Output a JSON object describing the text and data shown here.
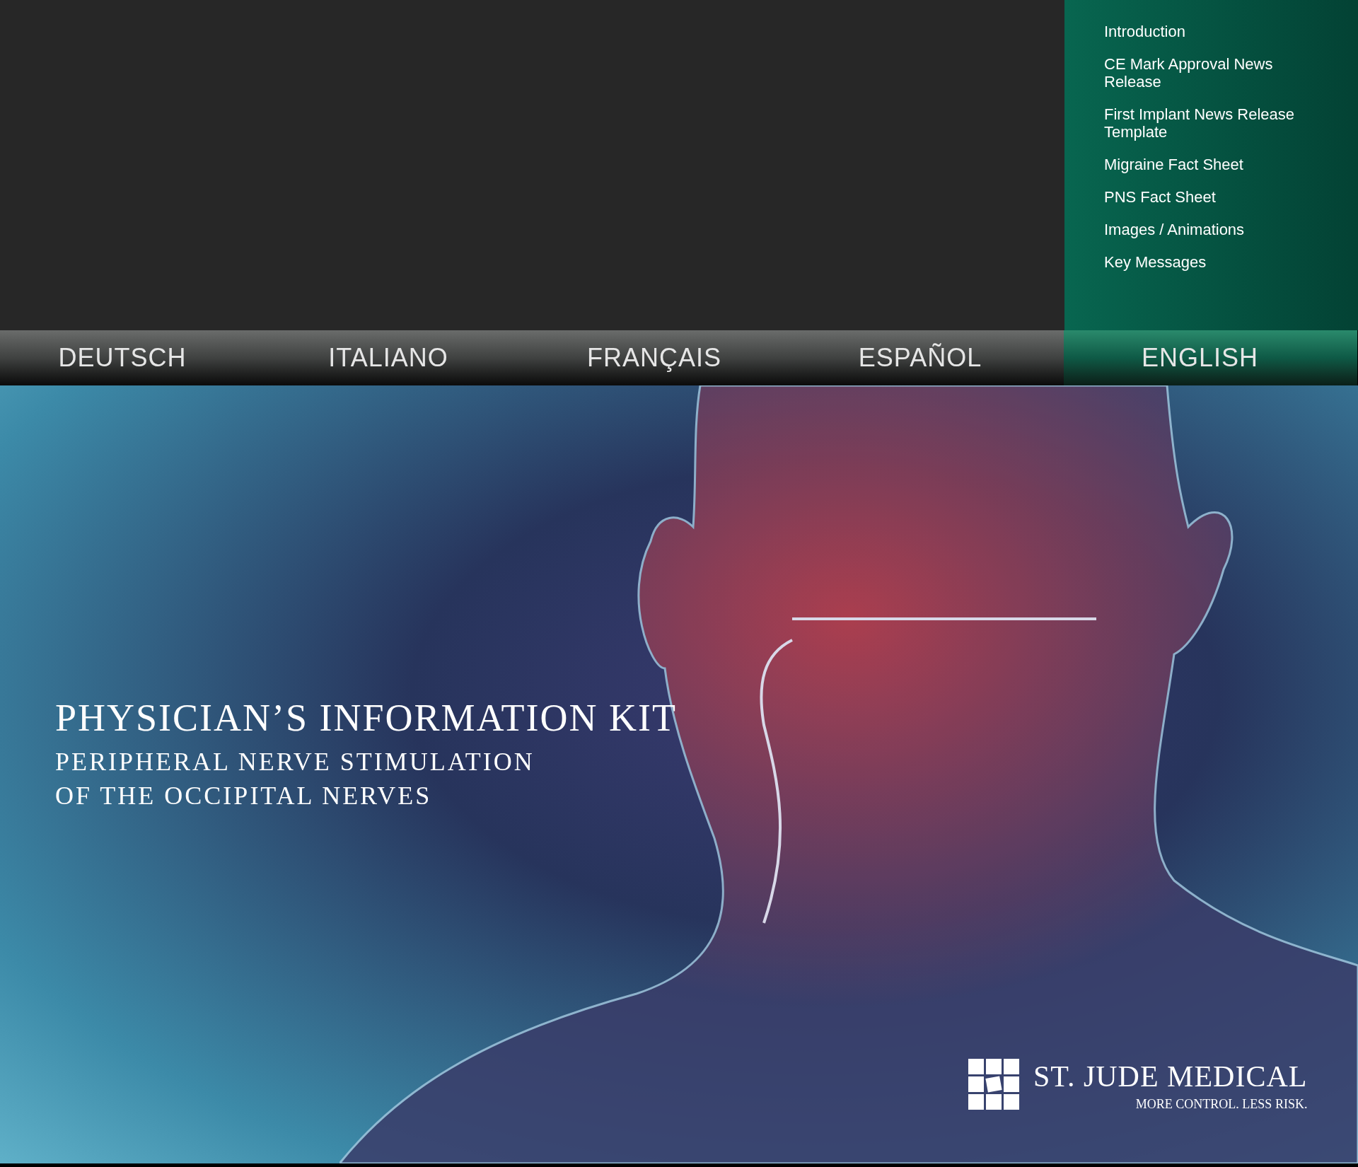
{
  "menu": {
    "items": [
      {
        "label": "Introduction"
      },
      {
        "label": "CE Mark Approval News Release"
      },
      {
        "label": "First Implant News Release Template"
      },
      {
        "label": "Migraine Fact Sheet"
      },
      {
        "label": "PNS Fact Sheet"
      },
      {
        "label": "Images / Animations"
      },
      {
        "label": "Key Messages"
      }
    ]
  },
  "languages": [
    {
      "label": "DEUTSCH",
      "selected": false
    },
    {
      "label": "ITALIANO",
      "selected": false
    },
    {
      "label": "FRANÇAIS",
      "selected": false
    },
    {
      "label": "ESPAÑOL",
      "selected": false
    },
    {
      "label": "ENGLISH",
      "selected": true
    }
  ],
  "hero": {
    "title": "PHYSICIAN’S INFORMATION KIT",
    "subtitle_lines": [
      "PERIPHERAL NERVE STIMULATION",
      "OF THE OCCIPITAL NERVES"
    ]
  },
  "logo": {
    "name": "ST. JUDE MEDICAL",
    "tagline": "MORE CONTROL. LESS RISK."
  }
}
